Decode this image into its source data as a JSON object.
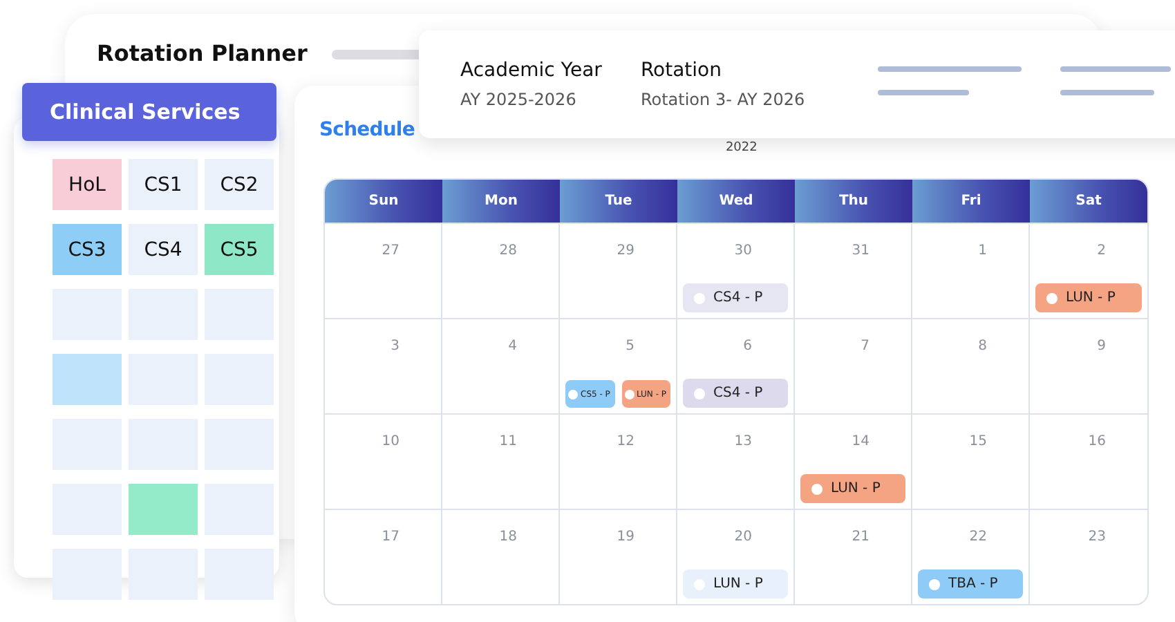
{
  "window": {
    "title": "Rotation Planner"
  },
  "services": {
    "title": "Clinical Services",
    "tiles": [
      {
        "label": "HoL",
        "color": "#f9cdd8"
      },
      {
        "label": "CS1",
        "color": "#ebf1fb"
      },
      {
        "label": "CS2",
        "color": "#ebf1fb"
      },
      {
        "label": "CS3",
        "color": "#8ecdf5"
      },
      {
        "label": "CS4",
        "color": "#ebf1fb"
      },
      {
        "label": "CS5",
        "color": "#8ee8c8"
      },
      {
        "color": "#ebf1fb"
      },
      {
        "color": "#ebf1fb"
      },
      {
        "color": "#ebf1fb"
      },
      {
        "color": "#bfe3fa"
      },
      {
        "color": "#ebf1fb"
      },
      {
        "color": "#ebf1fb"
      },
      {
        "color": "#ebf1fb"
      },
      {
        "color": "#ebf1fb"
      },
      {
        "color": "#ebf1fb"
      },
      {
        "color": "#ebf1fb"
      },
      {
        "color": "#93ebc9"
      },
      {
        "color": "#ebf1fb"
      },
      {
        "color": "#ebf1fb"
      },
      {
        "color": "#ebf1fb"
      },
      {
        "color": "#ebf1fb"
      }
    ]
  },
  "info": {
    "fields": [
      {
        "label": "Academic Year",
        "value": "AY 2025-2026"
      },
      {
        "label": "Rotation",
        "value": "Rotation 3- AY 2026"
      }
    ]
  },
  "schedule": {
    "title": "Schedule",
    "year": "2022",
    "weekdays": [
      "Sun",
      "Mon",
      "Tue",
      "Wed",
      "Thu",
      "Fri",
      "Sat"
    ],
    "weeks": [
      [
        {
          "date": "27"
        },
        {
          "date": "28"
        },
        {
          "date": "29"
        },
        {
          "date": "30",
          "events": [
            {
              "label": "CS4 - P",
              "color": "#e6e6f3",
              "kind": "normal"
            }
          ]
        },
        {
          "date": "31"
        },
        {
          "date": "1"
        },
        {
          "date": "2",
          "events": [
            {
              "label": "LUN - P",
              "color": "#f4a383",
              "kind": "normal"
            }
          ]
        }
      ],
      [
        {
          "date": "3"
        },
        {
          "date": "4"
        },
        {
          "date": "5",
          "events": [
            {
              "label": "CS5 - P",
              "color": "#8ecbf7",
              "kind": "small"
            },
            {
              "label": "LUN - P",
              "color": "#f4a383",
              "kind": "small"
            }
          ]
        },
        {
          "date": "6",
          "events": [
            {
              "label": "CS4 - P",
              "color": "#dcdaec",
              "kind": "normal"
            }
          ]
        },
        {
          "date": "7"
        },
        {
          "date": "8"
        },
        {
          "date": "9"
        }
      ],
      [
        {
          "date": "10"
        },
        {
          "date": "11"
        },
        {
          "date": "12"
        },
        {
          "date": "13"
        },
        {
          "date": "14",
          "events": [
            {
              "label": "LUN - P",
              "color": "#f4a383",
              "kind": "normal"
            }
          ]
        },
        {
          "date": "15"
        },
        {
          "date": "16"
        }
      ],
      [
        {
          "date": "17"
        },
        {
          "date": "18"
        },
        {
          "date": "19"
        },
        {
          "date": "20",
          "events": [
            {
              "label": "LUN - P",
              "color": "#e8f0fb",
              "kind": "normal"
            }
          ]
        },
        {
          "date": "21"
        },
        {
          "date": "22",
          "events": [
            {
              "label": "TBA - P",
              "color": "#8ecbf7",
              "kind": "normal"
            }
          ]
        },
        {
          "date": "23"
        }
      ]
    ]
  }
}
